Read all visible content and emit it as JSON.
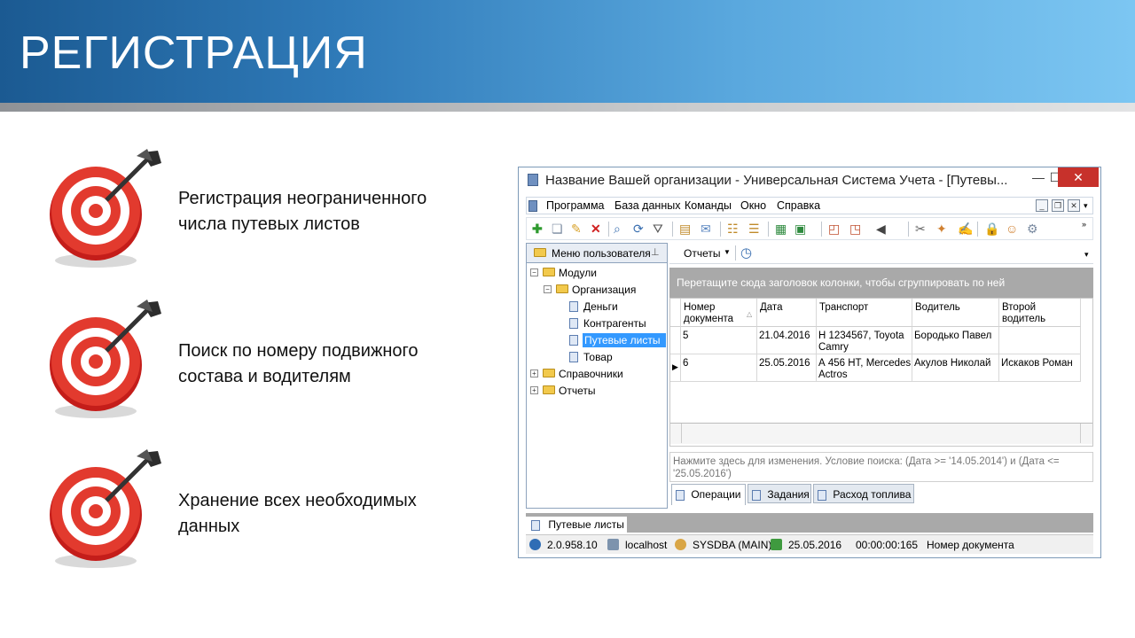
{
  "slide": {
    "title": "РЕГИСТРАЦИЯ",
    "bullets": [
      {
        "icon": "target-icon",
        "line1": "Регистрация неограниченного",
        "line2": "числа путевых листов"
      },
      {
        "icon": "target-icon",
        "line1": "Поиск по номеру подвижного",
        "line2": "состава и водителям"
      },
      {
        "icon": "target-icon",
        "line1": "Хранение всех необходимых",
        "line2": "данных"
      }
    ]
  },
  "window": {
    "title": "Название Вашей организации - Универсальная Система Учета - [Путевы...",
    "controls": {
      "minimize": "—",
      "maximize": "☐",
      "close": "✕"
    },
    "menu": [
      "Программа",
      "База данных",
      "Команды",
      "Окно",
      "Справка"
    ],
    "toolbar_icons": [
      "add-icon",
      "copy-icon",
      "edit-icon",
      "delete-icon",
      "search-icon",
      "refresh-icon",
      "filter-icon",
      "import-icon",
      "comment-icon",
      "tree-icon",
      "tree2-icon",
      "excel-icon",
      "export-icon",
      "new-window-icon",
      "close-window-icon",
      "sound-icon",
      "tools-icon",
      "magic-icon",
      "notes-icon",
      "lock-icon",
      "users-icon",
      "plugin-icon"
    ],
    "left_panel": {
      "header": "Меню пользователя",
      "tree": [
        {
          "label": "Модули",
          "level": 0,
          "expander": "−",
          "type": "folder"
        },
        {
          "label": "Организация",
          "level": 1,
          "expander": "−",
          "type": "folder"
        },
        {
          "label": "Деньги",
          "level": 2,
          "type": "doc"
        },
        {
          "label": "Контрагенты",
          "level": 2,
          "type": "doc"
        },
        {
          "label": "Путевые листы",
          "level": 2,
          "type": "doc",
          "selected": true
        },
        {
          "label": "Товар",
          "level": 2,
          "type": "doc"
        },
        {
          "label": "Справочники",
          "level": 0,
          "expander": "+",
          "type": "folder"
        },
        {
          "label": "Отчеты",
          "level": 0,
          "expander": "+",
          "type": "folder"
        }
      ]
    },
    "reports_button": "Отчеты",
    "group_hint": "Перетащите сюда заголовок колонки, чтобы сгруппировать по ней",
    "grid": {
      "columns": [
        "Номер документа",
        "Дата",
        "Транспорт",
        "Водитель",
        "Второй водитель"
      ],
      "rows": [
        [
          "5",
          "21.04.2016",
          "Н 1234567, Toyota Camry",
          "Бородько Павел",
          ""
        ],
        [
          "6",
          "25.05.2016",
          "А 456 НТ, Mercedes Actros",
          "Акулов Николай",
          "Искаков Роман"
        ]
      ],
      "current_row_marker": "▶"
    },
    "filter_text": "Нажмите здесь для изменения. Условие поиска: (Дата  >= '14.05.2014') и (Дата  <= '25.05.2016')",
    "tabs": [
      "Операции",
      "Задания",
      "Расход топлива"
    ],
    "bottom_tab": "Путевые листы",
    "status": {
      "version": "2.0.958.10",
      "host": "localhost",
      "user": "SYSDBA (MAIN)",
      "date": "25.05.2016",
      "time": "00:00:00:165",
      "field": "Номер документа"
    }
  }
}
